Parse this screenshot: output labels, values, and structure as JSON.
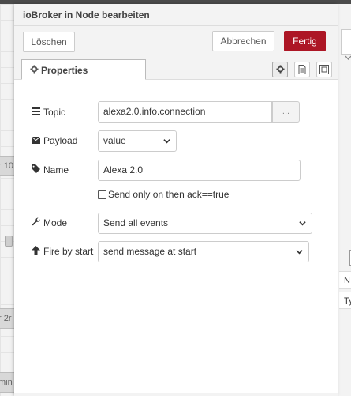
{
  "dialog": {
    "title": "ioBroker in Node bearbeiten"
  },
  "toolbar": {
    "delete_label": "Löschen",
    "cancel_label": "Abbrechen",
    "done_label": "Fertig"
  },
  "tabs": {
    "active_label": "Properties",
    "icons": [
      "gear-icon",
      "document-icon",
      "layout-icon"
    ]
  },
  "form": {
    "topic": {
      "label": "Topic",
      "value": "alexa2.0.info.connection",
      "browse_label": "..."
    },
    "payload": {
      "label": "Payload",
      "value": "value"
    },
    "name": {
      "label": "Name",
      "value": "Alexa 2.0"
    },
    "ack_checkbox": {
      "label": "Send only on then ack==true",
      "checked": false
    },
    "mode": {
      "label": "Mode",
      "value": "Send all events"
    },
    "fire_by_start": {
      "label": "Fire by start",
      "value": "send message at start"
    }
  },
  "workspace": {
    "node_labels": [
      "r 10",
      "r 2r",
      "min"
    ]
  },
  "sidebar": {
    "row_labels": [
      "N",
      "Ty"
    ]
  },
  "colors": {
    "primary": "#ad1625",
    "toolbar_bg": "#f3f3f3"
  }
}
